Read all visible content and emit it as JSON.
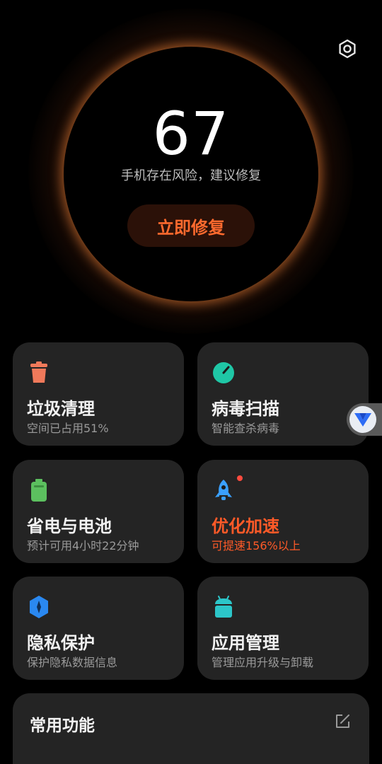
{
  "header": {
    "settings_icon": "gear-icon"
  },
  "score_panel": {
    "score": "67",
    "status_text": "手机存在风险，建议修复",
    "repair_button": "立即修复",
    "accent_color": "#ff6a2e"
  },
  "cards": [
    {
      "title": "垃圾清理",
      "subtitle": "空间已占用51%",
      "icon": "trash-icon",
      "icon_color": "#f0795a"
    },
    {
      "title": "病毒扫描",
      "subtitle": "智能查杀病毒",
      "icon": "gauge-icon",
      "icon_color": "#1fc7a6"
    },
    {
      "title": "省电与电池",
      "subtitle": "预计可用4小时22分钟",
      "icon": "battery-icon",
      "icon_color": "#5cc05f"
    },
    {
      "title": "优化加速",
      "subtitle": "可提速156%以上",
      "icon": "rocket-icon",
      "icon_color": "#3aa0ff",
      "highlight": true
    },
    {
      "title": "隐私保护",
      "subtitle": "保护隐私数据信息",
      "icon": "shield-icon",
      "icon_color": "#2a88f0"
    },
    {
      "title": "应用管理",
      "subtitle": "管理应用升级与卸载",
      "icon": "android-icon",
      "icon_color": "#2cc6c9"
    }
  ],
  "common": {
    "label": "常用功能",
    "edit_icon": "edit-icon"
  },
  "floating_badge": {
    "icon": "v-logo-icon"
  }
}
